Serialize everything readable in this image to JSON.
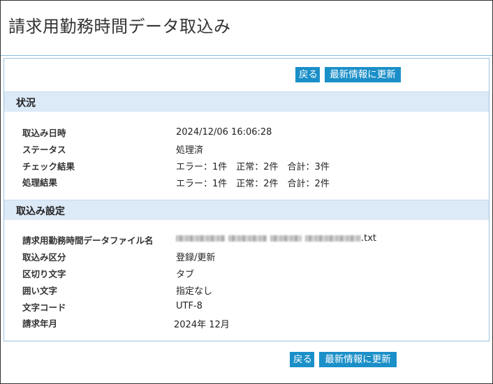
{
  "page": {
    "title": "請求用勤務時間データ取込み"
  },
  "toolbar": {
    "back_label": "戻る",
    "refresh_label": "最新情報に更新"
  },
  "status_section": {
    "title": "状況",
    "rows": [
      {
        "label": "取込み日時",
        "value": "2024/12/06 16:06:28"
      },
      {
        "label": "ステータス",
        "value": "処理済"
      },
      {
        "label": "チェック結果",
        "value": "エラー：1件　正常：2件　合計：3件"
      },
      {
        "label": "処理結果",
        "value": "エラー：1件　正常：2件　合計：2件"
      }
    ]
  },
  "settings_section": {
    "title": "取込み設定",
    "rows": [
      {
        "label": "請求用勤務時間データファイル名",
        "value": ".txt"
      },
      {
        "label": "取込み区分",
        "value": "登録/更新"
      },
      {
        "label": "区切り文字",
        "value": "タブ"
      },
      {
        "label": "囲い文字",
        "value": "指定なし"
      },
      {
        "label": "文字コード",
        "value": "UTF-8"
      },
      {
        "label": "請求年月",
        "value": "2024年 12月"
      }
    ]
  },
  "footer": {
    "back_label": "戻る",
    "refresh_label": "最新情報に更新"
  }
}
